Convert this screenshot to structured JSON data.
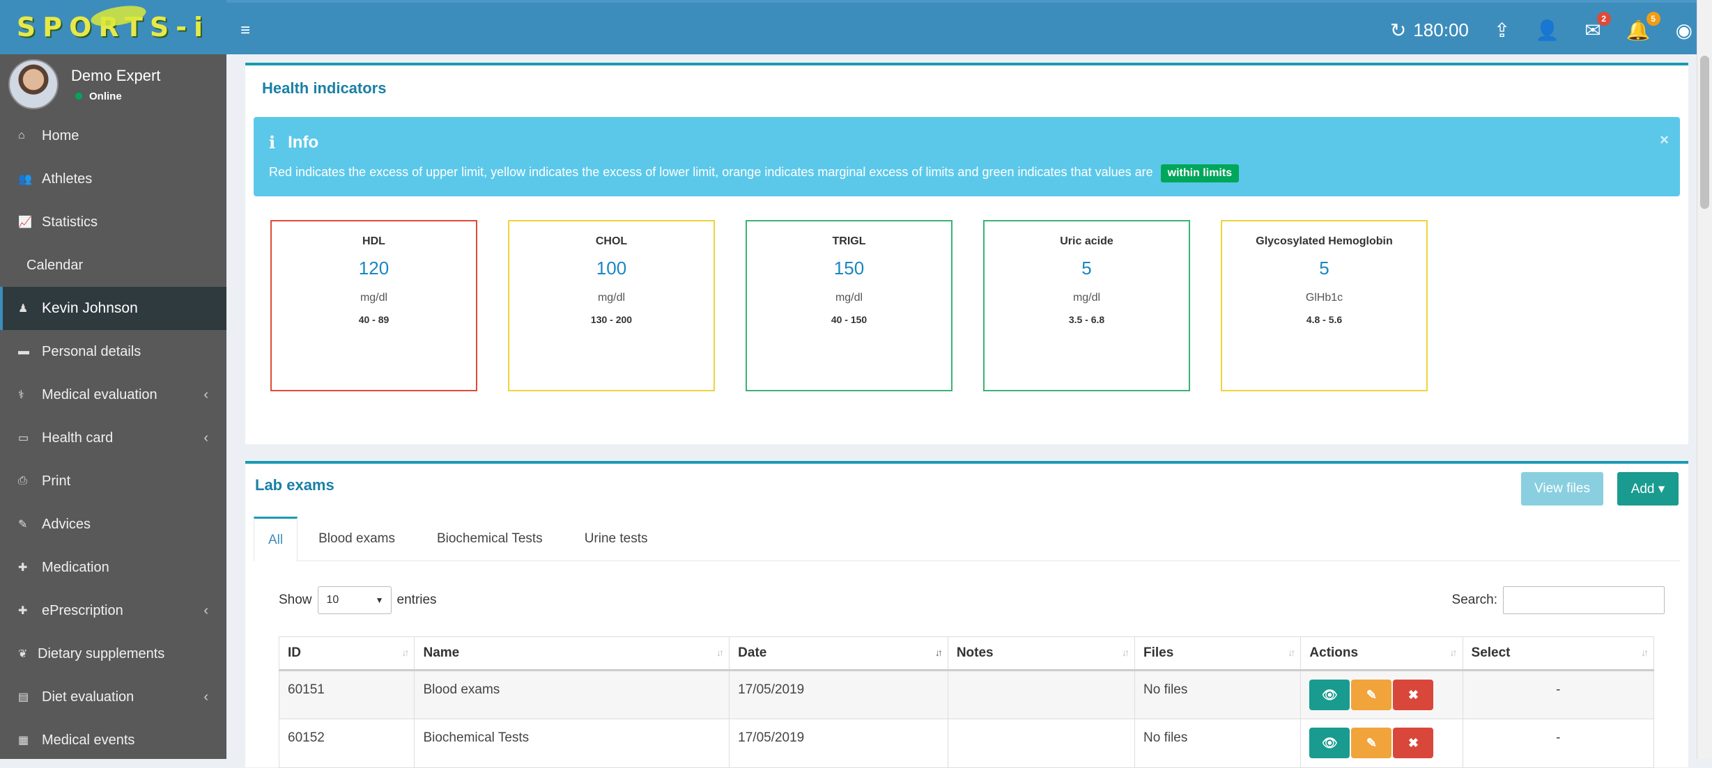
{
  "app": {
    "logo_text": "SPORTS-i",
    "user_name": "Demo Expert",
    "user_status": "Online"
  },
  "sidebar": {
    "items": [
      {
        "label": "Home",
        "icon": "home-icon"
      },
      {
        "label": "Athletes",
        "icon": "users-icon"
      },
      {
        "label": "Statistics",
        "icon": "line-chart-icon"
      },
      {
        "label": "Calendar",
        "icon": ""
      },
      {
        "label": "Kevin Johnson",
        "icon": "person-icon"
      },
      {
        "label": "Personal details",
        "icon": "folder-icon"
      },
      {
        "label": "Medical evaluation",
        "icon": "stethoscope-icon"
      },
      {
        "label": "Health card",
        "icon": "id-card-icon"
      },
      {
        "label": "Print",
        "icon": "print-icon"
      },
      {
        "label": "Advices",
        "icon": "paperclip-icon"
      },
      {
        "label": "Medication",
        "icon": "medkit-icon"
      },
      {
        "label": "ePrescription",
        "icon": "medkit-icon"
      },
      {
        "label": "Dietary supplements",
        "icon": "leaf-icon"
      },
      {
        "label": "Diet evaluation",
        "icon": "file-icon"
      },
      {
        "label": "Medical events",
        "icon": "calendar-icon"
      }
    ]
  },
  "topbar": {
    "timer": "180:00",
    "mail_badge": "2",
    "bell_badge": "5"
  },
  "health": {
    "title": "Health indicators",
    "info_title": "Info",
    "info_close": "×",
    "info_text": "Red indicates the excess of upper limit, yellow indicates the excess of lower limit, orange indicates marginal excess of limits and green indicates that values are",
    "info_label": "within limits",
    "indicators": [
      {
        "name": "HDL",
        "value": "120",
        "unit": "mg/dl",
        "range": "40 - 89",
        "color": "#dd4b39"
      },
      {
        "name": "CHOL",
        "value": "100",
        "unit": "mg/dl",
        "range": "130 - 200",
        "color": "#f0d33a"
      },
      {
        "name": "TRIGL",
        "value": "150",
        "unit": "mg/dl",
        "range": "40 - 150",
        "color": "#3bb273"
      },
      {
        "name": "Uric acide",
        "value": "5",
        "unit": "mg/dl",
        "range": "3.5 - 6.8",
        "color": "#3bb273"
      },
      {
        "name": "Glycosylated Hemoglobin",
        "value": "5",
        "unit": "GlHb1c",
        "range": "4.8 - 5.6",
        "color": "#f0d33a"
      }
    ]
  },
  "lab": {
    "title": "Lab exams",
    "view_files": "View files",
    "add": "Add ▾",
    "tabs": [
      "All",
      "Blood exams",
      "Biochemical Tests",
      "Urine tests"
    ],
    "show_label": "Show",
    "entries_value": "10",
    "entries_label": "entries",
    "search_label": "Search:",
    "columns": [
      "ID",
      "Name",
      "Date",
      "Notes",
      "Files",
      "Actions",
      "Select"
    ],
    "rows": [
      {
        "id": "60151",
        "name": "Blood exams",
        "date": "17/05/2019",
        "notes": "",
        "files": "No files",
        "select": "-"
      },
      {
        "id": "60152",
        "name": "Biochemical Tests",
        "date": "17/05/2019",
        "notes": "",
        "files": "No files",
        "select": "-"
      }
    ]
  }
}
